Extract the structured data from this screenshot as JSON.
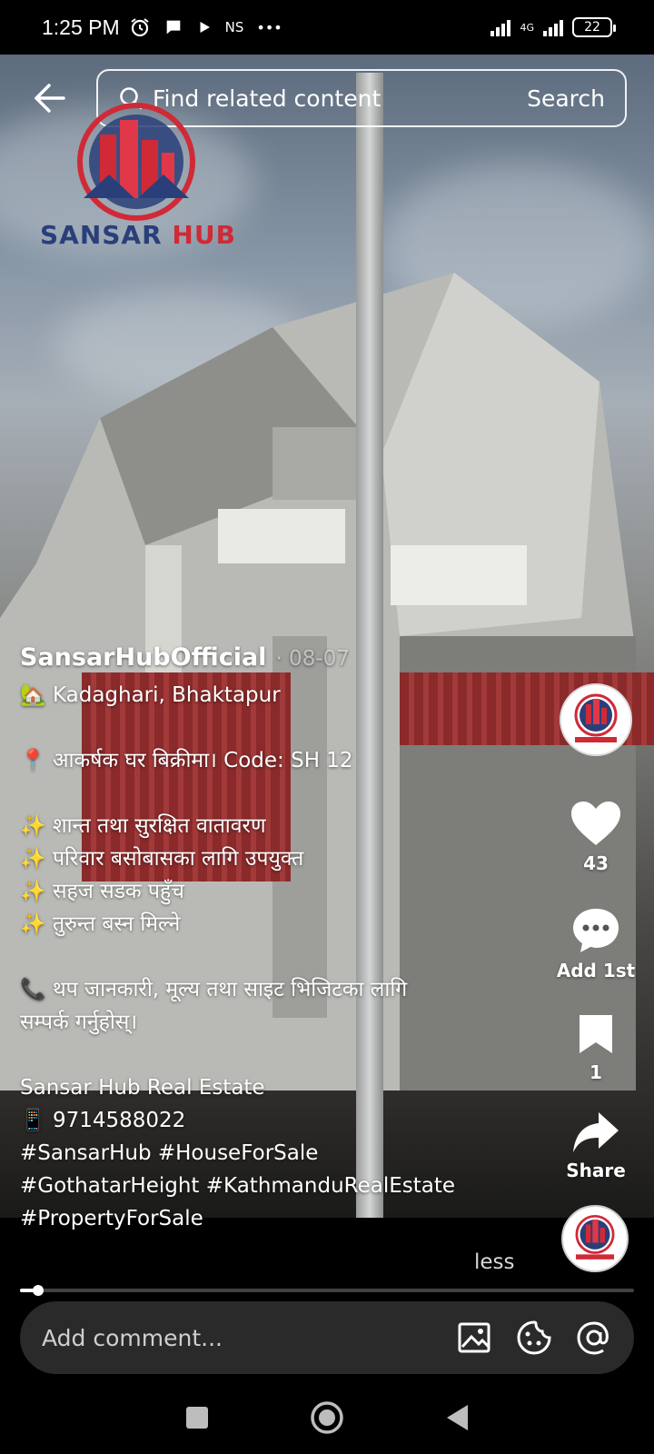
{
  "status_bar": {
    "time": "1:25 PM",
    "network_label": "4G",
    "ns_label": "NS",
    "more_dots": "•••",
    "battery": "22"
  },
  "search": {
    "placeholder": "Find related content",
    "button_label": "Search"
  },
  "brand": {
    "name_part1": "SANSAR ",
    "name_part2": "HUB"
  },
  "post": {
    "author": "SansarHubOfficial",
    "date": "· 08-07",
    "caption_lines": [
      "🏡 Kadaghari, Bhaktapur",
      "",
      "📍 आकर्षक घर बिक्रीमा। Code: SH 12",
      "",
      "✨ शान्त तथा सुरक्षित वातावरण",
      "✨ परिवार बसोबासका लागि उपयुक्त",
      "✨ सहज सडक पहुँच",
      "✨ तुरुन्त बस्न मिल्ने",
      "",
      "📞 थप जानकारी, मूल्य तथा साइट भिजिटका लागि",
      "सम्पर्क गर्नुहोस्।",
      "",
      "Sansar Hub Real Estate",
      "📱 9714588022",
      "#SansarHub #HouseForSale",
      "#GothatarHeight #KathmanduRealEstate",
      "#PropertyForSale"
    ],
    "less_label": "less",
    "progress": 0.03
  },
  "actions": {
    "likes": "43",
    "comment_label": "Add 1st",
    "bookmarks": "1",
    "share_label": "Share"
  },
  "comment": {
    "placeholder": "Add comment..."
  },
  "colors": {
    "brand_blue": "#2a3f7a",
    "brand_red": "#d02a36"
  }
}
